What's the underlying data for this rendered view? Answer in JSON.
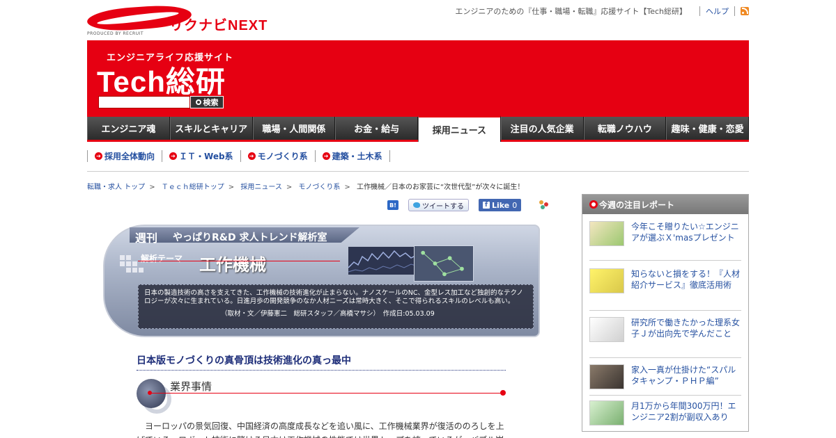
{
  "header": {
    "logo_text": "リクナビNEXT",
    "produced_by": "PRODUCED BY RECRUIT",
    "tagline": "エンジニアのための『仕事・職場・転職』応援サイト【Tech総研】",
    "help_label": "ヘルプ",
    "site_subtitle": "エンジニアライフ応援サイト",
    "site_title": "Tech総研",
    "search_placeholder": "",
    "search_button": "検索"
  },
  "nav": {
    "items": [
      {
        "label": "エンジニア魂"
      },
      {
        "label": "スキルとキャリア"
      },
      {
        "label": "職場・人間関係"
      },
      {
        "label": "お金・給与"
      },
      {
        "label": "採用ニュース"
      },
      {
        "label": "注目の人気企業"
      },
      {
        "label": "転職ノウハウ"
      },
      {
        "label": "趣味・健康・恋愛"
      }
    ],
    "active_index": 4
  },
  "subnav": {
    "items": [
      {
        "label": "採用全体動向"
      },
      {
        "label": "ＩＴ・Web系"
      },
      {
        "label": "モノづくり系"
      },
      {
        "label": "建築・土木系"
      }
    ]
  },
  "breadcrumb": {
    "items": [
      {
        "label": "転職・求人 トップ"
      },
      {
        "label": "Ｔｅｃｈ総研トップ"
      },
      {
        "label": "採用ニュース"
      },
      {
        "label": "モノづくり系"
      }
    ],
    "current": "工作機械／日本のお家芸に“次世代型”が次々に誕生！"
  },
  "social": {
    "hatena_label": "B!",
    "tweet_label": "ツイートする",
    "like_label": "Like",
    "like_count": "0"
  },
  "hero": {
    "weekly": "週刊",
    "series": "やっぱりR&D 求人トレンド解析室",
    "theme_label": "解析テーマ",
    "theme": "工作機械",
    "description": "日本の製造技術の高さを支えてきた、工作機械の技術進化が止まらない。ナノスケールのNC、金型レス加工など独創的なテクノロジーが次々に生まれている。日進月歩の開発競争のなか人材ニーズは常時大きく、そこで得られるスキルのレベルも高い。",
    "credit": "（取材・文／伊藤憲二　総研スタッフ／高橋マサシ）　作成日:05.03.09"
  },
  "article": {
    "title": "日本版モノづくりの真骨頂は技術進化の真っ最中",
    "section": "業界事情",
    "body": "ヨーロッパの景気回復、中国経済の高度成長などを追い風に、工作機械業界が復活ののろしを上げている。ロボット技術に賭ける日本は工作機械の性能では世界トップを誇っているが、バブル崩"
  },
  "sidebar": {
    "title": "今週の注目レポート",
    "items": [
      {
        "text": "今年こそ贈りたい☆エンジニアが選ぶＸ'masプレゼント"
      },
      {
        "text": "知らないと損をする！『人材紹介サービス』徹底活用術"
      },
      {
        "text": "研究所で働きたかった理系女子Ｊが出向先で学んだこと"
      },
      {
        "text": "家入一真が仕掛けた“スパルタキャンプ・ＰＨＰ編”"
      },
      {
        "text": "月1万から年間300万円！エンジニア2割が副収入あり"
      }
    ]
  },
  "colors": {
    "brand_red": "#e60012",
    "link_blue": "#2550a0",
    "nav_dark": "#333333"
  }
}
